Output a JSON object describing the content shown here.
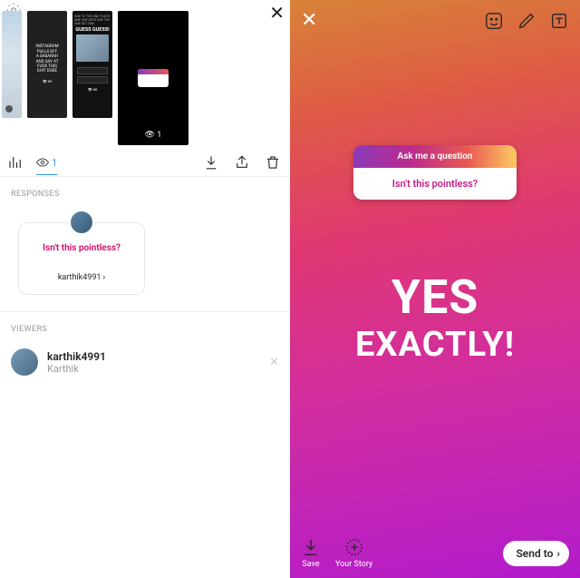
{
  "left": {
    "thumbs": {
      "t2_lines": [
        "INSTAGRAM",
        "PULLS OFF",
        "A SABARAH",
        "AND SAY AT",
        "FUCK THIS",
        "SHIT DUDE"
      ],
      "t2_count": "89",
      "t3_header": "ONE TO THE ONE THATS ONE ONE GETS ONE THE ONE GET ONE",
      "t3_guess": "GUESS GUESS!",
      "t3_count": "88",
      "t4_views": "1"
    },
    "views_count": "1",
    "responses_label": "RESPONSES",
    "response": {
      "question": "Isn't this pointless?",
      "user": "karthik4991"
    },
    "viewers_label": "VIEWERS",
    "viewer": {
      "username": "karthik4991",
      "name": "Karthik"
    }
  },
  "right": {
    "question_card": {
      "header": "Ask me a question",
      "body": "Isn't this pointless?"
    },
    "big_line1": "YES",
    "big_line2": "EXACTLY!",
    "save_label": "Save",
    "your_story_label": "Your Story",
    "send_label": "Send to"
  }
}
